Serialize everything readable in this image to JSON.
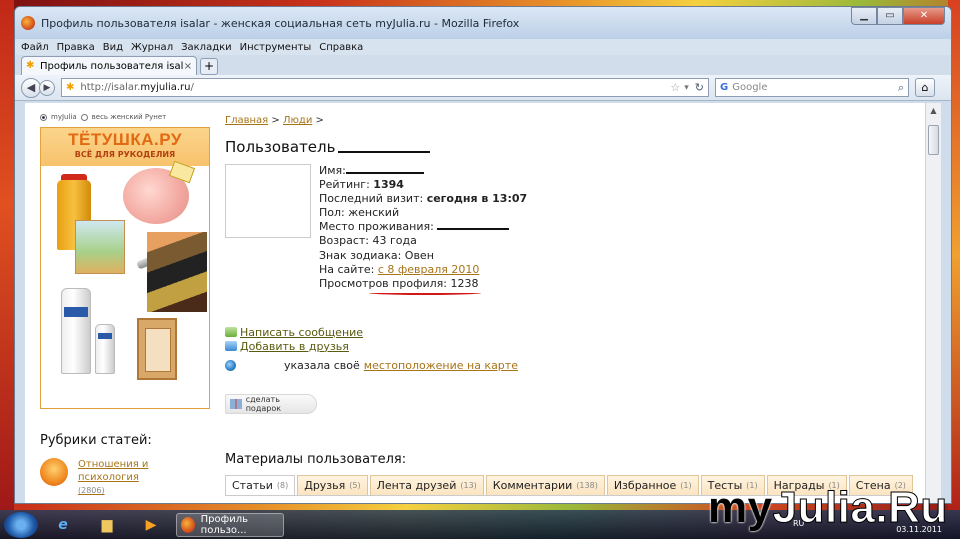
{
  "window": {
    "title": "Профиль пользователя isalar - женская социальная сеть myJulia.ru - Mozilla Firefox"
  },
  "menu": [
    "Файл",
    "Правка",
    "Вид",
    "Журнал",
    "Закладки",
    "Инструменты",
    "Справка"
  ],
  "tab": {
    "label": "Профиль пользователя isalar - женска...",
    "close": "×",
    "new": "+"
  },
  "nav": {
    "url_prefix": "http://isalar.",
    "url_domain": "myjulia.ru",
    "url_suffix": "/",
    "search_placeholder": "Google"
  },
  "sidebar": {
    "radio1": "myJulia",
    "radio2": "весь женский Рунет",
    "ad_title": "ТЁТУШКА.РУ",
    "ad_subtitle": "ВСЁ ДЛЯ РУКОДЕЛИЯ",
    "rubrics_title": "Рубрики статей:",
    "rubric_link": "Отношения и психология",
    "rubric_count": "(2806)"
  },
  "breadcrumb": {
    "home": "Главная",
    "sep1": ">",
    "people": "Люди",
    "sep2": ">"
  },
  "profile": {
    "title": "Пользователь",
    "name_label": "Имя:",
    "rating_label": "Рейтинг:",
    "rating_value": "1394",
    "last_visit_label": "Последний визит:",
    "last_visit_value": "сегодня в 13:07",
    "gender": "Пол: женский",
    "residence_label": "Место проживания:",
    "age": "Возраст: 43 года",
    "zodiac": "Знак зодиака: Овен",
    "since_label": "На сайте:",
    "since_value": "с 8 февраля 2010",
    "views": "Просмотров профиля: 1238"
  },
  "actions": {
    "message": "Написать сообщение",
    "add_friend": "Добавить в друзья",
    "location_text": "указала своё",
    "location_link": "местоположение на карте",
    "gift": "сделать подарок"
  },
  "materials": {
    "title": "Материалы пользователя:",
    "tabs": [
      {
        "label": "Статьи",
        "count": "(8)"
      },
      {
        "label": "Друзья",
        "count": "(5)"
      },
      {
        "label": "Лента друзей",
        "count": "(13)"
      },
      {
        "label": "Комментарии",
        "count": "(138)"
      },
      {
        "label": "Избранное",
        "count": "(1)"
      },
      {
        "label": "Тесты",
        "count": "(1)"
      },
      {
        "label": "Награды",
        "count": "(1)"
      },
      {
        "label": "Стена",
        "count": "(2)"
      }
    ]
  },
  "taskbar": {
    "task_label": "Профиль пользо...",
    "lang": "RU",
    "date": "03.11.2011"
  },
  "watermark": {
    "part1": "my",
    "part2": "Julia.Ru"
  }
}
